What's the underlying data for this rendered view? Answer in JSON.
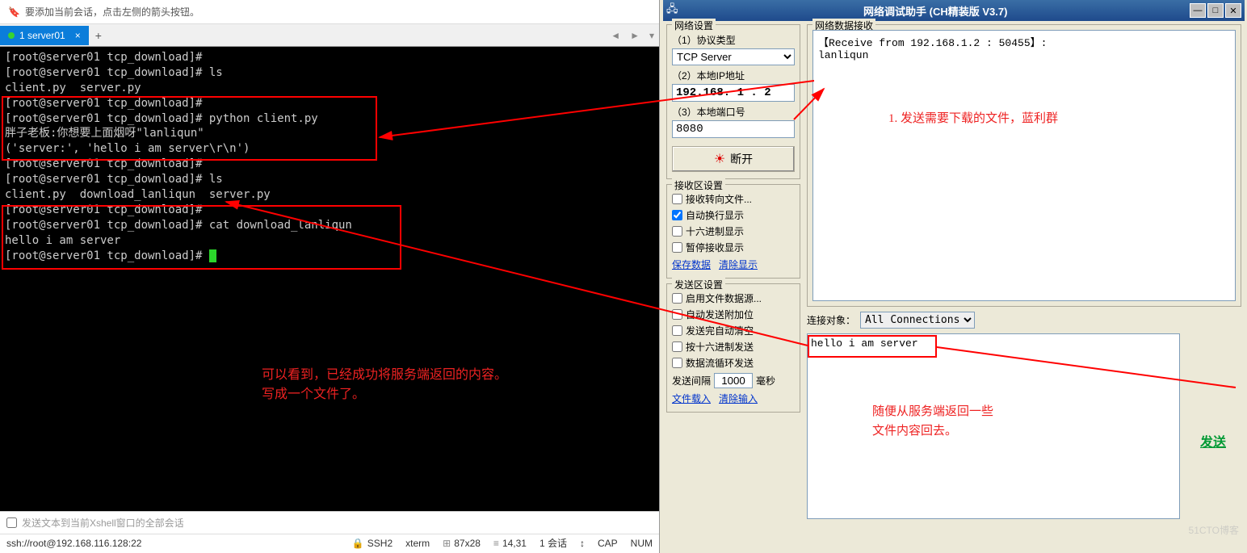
{
  "left": {
    "hint": "要添加当前会话，点击左侧的箭头按钮。",
    "tab_label": "1 server01",
    "terminal_lines": [
      "[root@server01 tcp_download]#",
      "[root@server01 tcp_download]# ls",
      "client.py  server.py",
      "[root@server01 tcp_download]#",
      "[root@server01 tcp_download]# python client.py",
      "胖子老板:你想要上面烟呀\"lanliqun\"",
      "('server:', 'hello i am server\\r\\n')",
      "[root@server01 tcp_download]#",
      "[root@server01 tcp_download]# ls",
      "client.py  download_lanliqun  server.py",
      "[root@server01 tcp_download]#",
      "[root@server01 tcp_download]# cat download_lanliqun",
      "hello i am server",
      "[root@server01 tcp_download]# "
    ],
    "bottom_placeholder": "发送文本到当前Xshell窗口的全部会话",
    "anno1_line1": "可以看到，已经成功将服务端返回的内容。",
    "anno1_line2": "写成一个文件了。",
    "status": {
      "conn": "ssh://root@192.168.116.128:22",
      "proto": "SSH2",
      "term": "xterm",
      "size": "87x28",
      "pos": "14,31",
      "sess": "1 会话",
      "cap": "CAP",
      "num": "NUM"
    }
  },
  "right": {
    "title": "网络调试助手  (CH精装版 V3.7)",
    "net_settings": {
      "title": "网络设置",
      "proto_label": "（1）协议类型",
      "proto_value": "TCP Server",
      "ip_label": "（2）本地IP地址",
      "ip_value": "192.168. 1 . 2",
      "port_label": "（3）本地端口号",
      "port_value": "8080",
      "disconnect_btn": "断开"
    },
    "recv_settings": {
      "title": "接收区设置",
      "opt1": "接收转向文件...",
      "opt2": "自动换行显示",
      "opt3": "十六进制显示",
      "opt4": "暂停接收显示",
      "link_save": "保存数据",
      "link_clear": "清除显示"
    },
    "send_settings": {
      "title": "发送区设置",
      "opt1": "启用文件数据源...",
      "opt2": "自动发送附加位",
      "opt3": "发送完自动清空",
      "opt4": "按十六进制发送",
      "opt5": "数据流循环发送",
      "interval_label": "发送间隔",
      "interval_value": "1000",
      "interval_unit": "毫秒",
      "link_load": "文件载入",
      "link_clear": "清除输入"
    },
    "recv_area": {
      "title": "网络数据接收",
      "line1": "【Receive from 192.168.1.2 : 50455】:",
      "line2": "lanliqun"
    },
    "conn_label": "连接对象：",
    "conn_value": "All Connections",
    "send_text": "hello i am server",
    "send_btn": "发送",
    "anno_recv": "1. 发送需要下载的文件，蓝利群",
    "anno_send_l1": "随便从服务端返回一些",
    "anno_send_l2": "文件内容回去。"
  },
  "watermark": "51CTO博客"
}
